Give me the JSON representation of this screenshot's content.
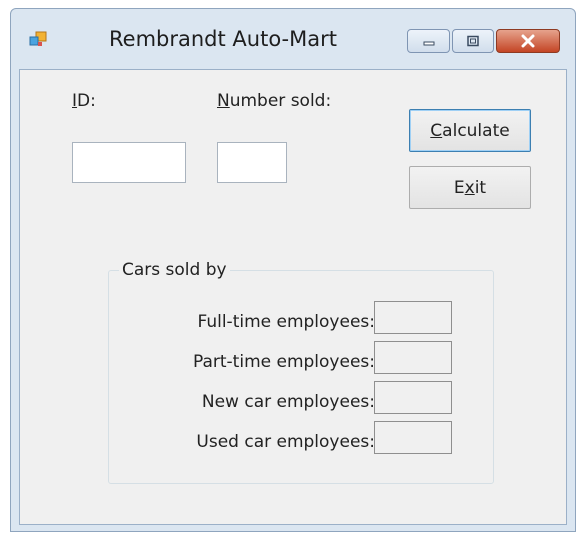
{
  "window": {
    "title": "Rembrandt Auto-Mart"
  },
  "form": {
    "id_label_hotkey": "I",
    "id_label_rest": "D:",
    "number_sold_label_hotkey": "N",
    "number_sold_label_rest": "umber sold:",
    "id_value": "",
    "number_sold_value": ""
  },
  "buttons": {
    "calculate_hotkey": "C",
    "calculate_rest": "alculate",
    "exit_before": "E",
    "exit_hotkey": "x",
    "exit_after": "it"
  },
  "group": {
    "title": "Cars sold by",
    "rows": [
      {
        "label": "Full-time employees:",
        "value": ""
      },
      {
        "label": "Part-time employees:",
        "value": ""
      },
      {
        "label": "New car employees:",
        "value": ""
      },
      {
        "label": "Used car employees:",
        "value": ""
      }
    ]
  },
  "icons": {
    "app": "app-icon",
    "minimize": "minimize-icon",
    "maximize": "maximize-icon",
    "close": "close-icon"
  },
  "colors": {
    "frame": "#dbe6f1",
    "client": "#f0f0f0",
    "close_button": "#c44525",
    "default_button_border": "#3c7fb1"
  }
}
